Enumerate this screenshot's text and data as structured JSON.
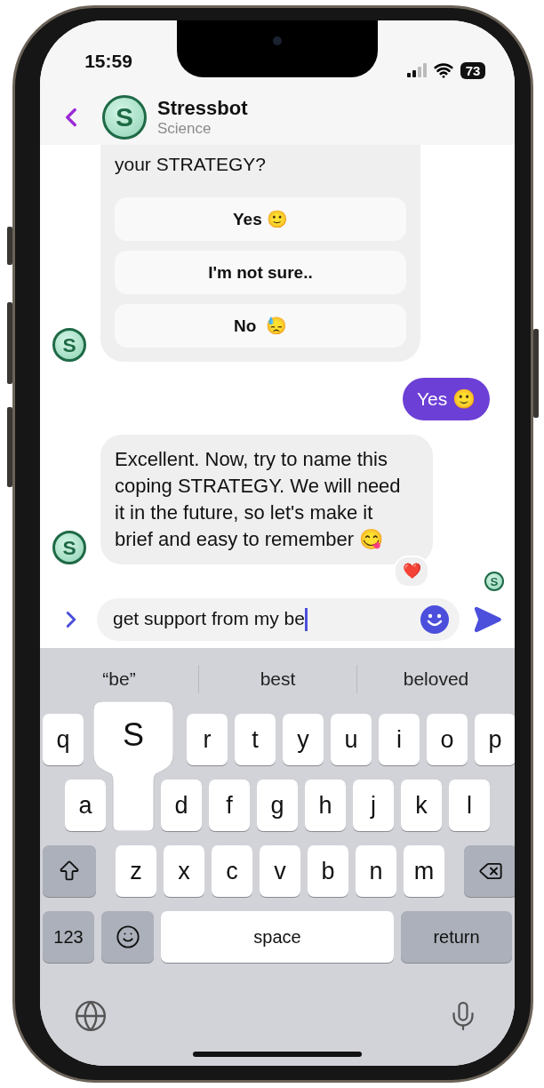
{
  "status_bar": {
    "time": "15:59",
    "battery": "73"
  },
  "header": {
    "title": "Stressbot",
    "subtitle": "Science",
    "avatar_letter": "S"
  },
  "messages": [
    {
      "kind": "bot_options",
      "avatar_letter": "S",
      "text": "your STRATEGY?",
      "options": [
        "Yes 🙂",
        "I'm not sure..",
        "No  😓"
      ]
    },
    {
      "kind": "user",
      "text": "Yes 🙂"
    },
    {
      "kind": "bot",
      "avatar_letter": "S",
      "text": "Excellent. Now, try to name this coping STRATEGY. We will need it in the future, so let's make it brief and easy to remember 😋",
      "reaction": "❤️"
    }
  ],
  "read_receipt": {
    "avatar_letter": "S"
  },
  "composer": {
    "value": "get support from my be"
  },
  "keyboard": {
    "suggestions": [
      "“be”",
      "best",
      "beloved"
    ],
    "rows": [
      [
        {
          "kind": "letter",
          "label": "q"
        },
        {
          "kind": "covered"
        },
        {
          "kind": "covered"
        },
        {
          "kind": "letter",
          "label": "r"
        },
        {
          "kind": "letter",
          "label": "t"
        },
        {
          "kind": "letter",
          "label": "y"
        },
        {
          "kind": "letter",
          "label": "u"
        },
        {
          "kind": "letter",
          "label": "i"
        },
        {
          "kind": "letter",
          "label": "o"
        },
        {
          "kind": "letter",
          "label": "p"
        }
      ],
      [
        {
          "kind": "letter",
          "label": "a"
        },
        {
          "kind": "covered"
        },
        {
          "kind": "letter",
          "label": "d"
        },
        {
          "kind": "letter",
          "label": "f"
        },
        {
          "kind": "letter",
          "label": "g"
        },
        {
          "kind": "letter",
          "label": "h"
        },
        {
          "kind": "letter",
          "label": "j"
        },
        {
          "kind": "letter",
          "label": "k"
        },
        {
          "kind": "letter",
          "label": "l"
        }
      ],
      [
        {
          "kind": "shift"
        },
        {
          "kind": "letter",
          "label": "z"
        },
        {
          "kind": "letter",
          "label": "x"
        },
        {
          "kind": "letter",
          "label": "c"
        },
        {
          "kind": "letter",
          "label": "v"
        },
        {
          "kind": "letter",
          "label": "b"
        },
        {
          "kind": "letter",
          "label": "n"
        },
        {
          "kind": "letter",
          "label": "m"
        },
        {
          "kind": "delete"
        }
      ]
    ],
    "bottom_row": [
      {
        "kind": "mode",
        "label": "123"
      },
      {
        "kind": "emoji"
      },
      {
        "kind": "space",
        "label": "space"
      },
      {
        "kind": "return",
        "label": "return"
      }
    ],
    "key_preview": {
      "label": "S"
    }
  }
}
